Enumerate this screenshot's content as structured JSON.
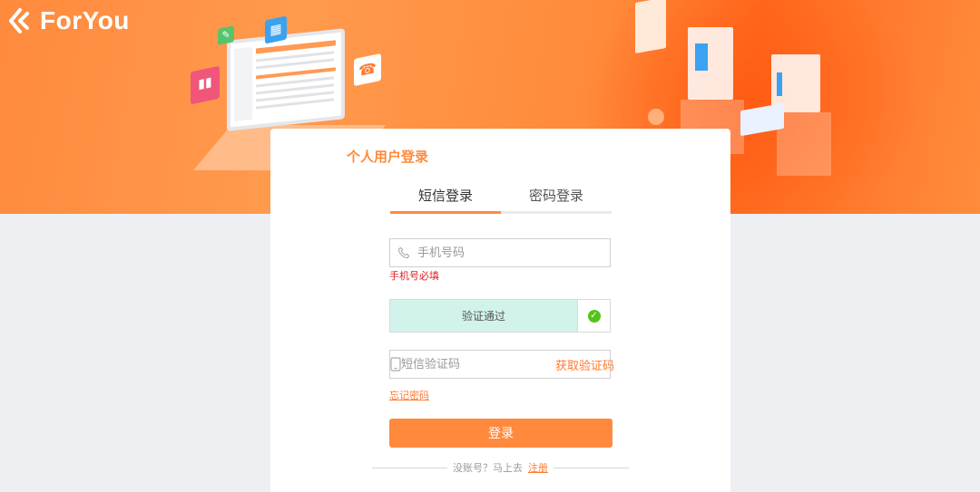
{
  "brand": {
    "name": "ForYou",
    "logo_icon": "foryou-logo-icon",
    "accent_color": "#ff8a3d"
  },
  "card": {
    "title": "个人用户登录",
    "tabs": [
      {
        "label": "短信登录",
        "active": true
      },
      {
        "label": "密码登录",
        "active": false
      }
    ],
    "phone": {
      "placeholder": "手机号码",
      "value": "",
      "icon": "phone-icon"
    },
    "phone_error": "手机号必填",
    "captcha": {
      "status_text": "验证通过",
      "icon": "check-circle-icon"
    },
    "sms": {
      "placeholder": "短信验证码",
      "value": "",
      "icon": "mobile-icon",
      "get_code_label": "获取验证码"
    },
    "forgot_label": "忘记密码",
    "login_label": "登录",
    "no_account_text": "没账号？马上去",
    "register_label": "注册"
  }
}
